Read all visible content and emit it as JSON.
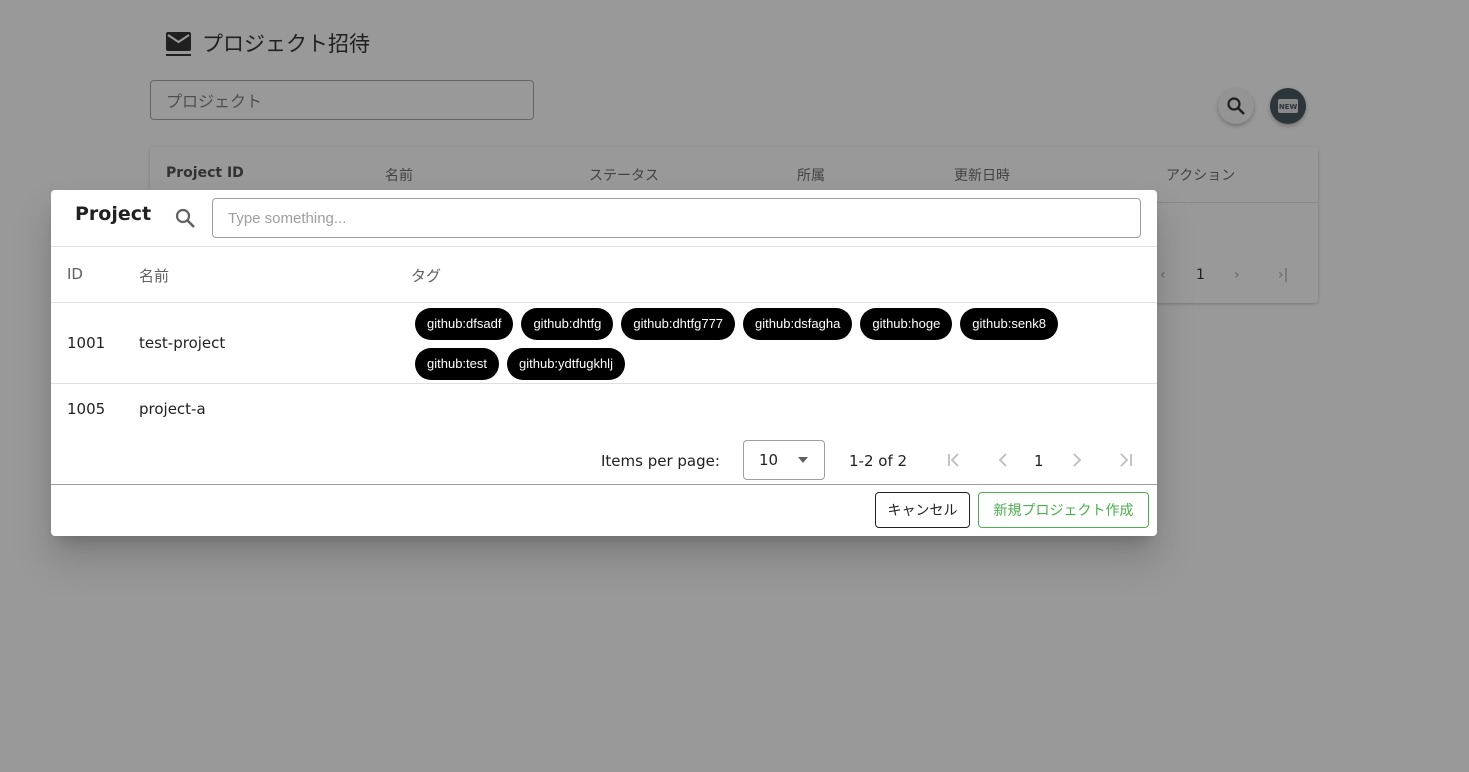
{
  "page": {
    "title": "プロジェクト招待",
    "filter_placeholder": "プロジェクト",
    "table_headers": [
      "Project ID",
      "名前",
      "ステータス",
      "所属",
      "更新日時",
      "アクション"
    ],
    "pager_page": "1",
    "new_badge": "NEW"
  },
  "dialog": {
    "title": "Project",
    "search_placeholder": "Type something...",
    "headers": {
      "id": "ID",
      "name": "名前",
      "tags": "タグ"
    },
    "rows": [
      {
        "id": "1001",
        "name": "test-project",
        "tags": [
          "github:dfsadf",
          "github:dhtfg",
          "github:dhtfg777",
          "github:dsfagha",
          "github:hoge",
          "github:senk8",
          "github:test",
          "github:ydtfugkhlj"
        ]
      },
      {
        "id": "1005",
        "name": "project-a",
        "tags": []
      }
    ],
    "pagination": {
      "items_per_page_label": "Items per page:",
      "items_per_page": "10",
      "range": "1-2 of 2",
      "page": "1"
    },
    "actions": {
      "cancel": "キャンセル",
      "create": "新規プロジェクト作成"
    },
    "colors": {
      "chip_bg": "#000000",
      "create_accent": "#4caf50"
    }
  }
}
